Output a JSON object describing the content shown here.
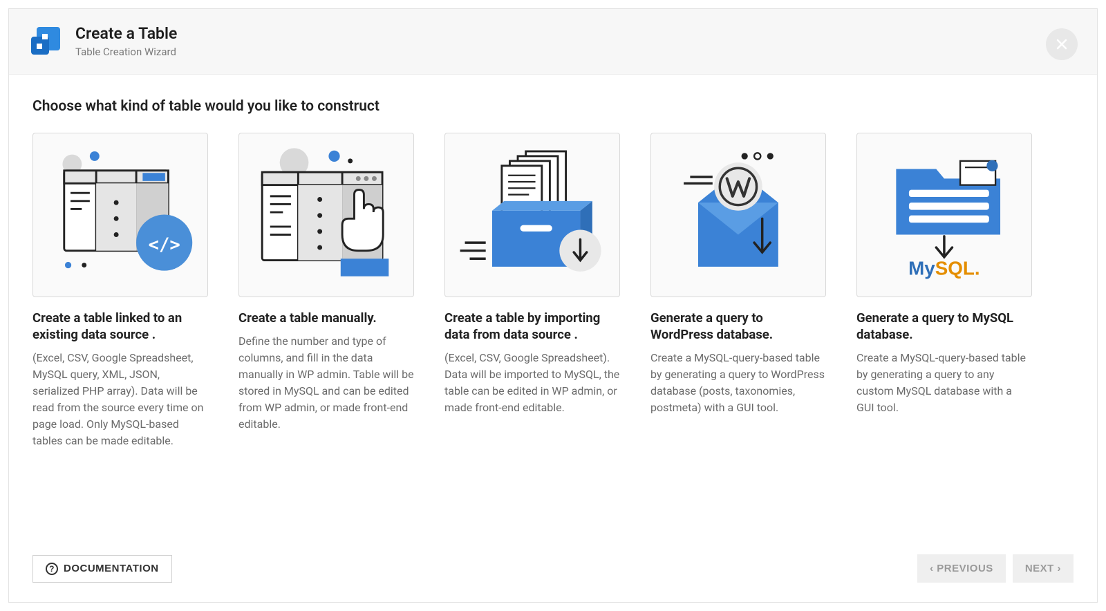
{
  "header": {
    "title": "Create a Table",
    "subtitle": "Table Creation Wizard"
  },
  "prompt": "Choose what kind of table would you like to construct",
  "cards": [
    {
      "title": "Create a table linked to an existing data source .",
      "desc": "(Excel, CSV, Google Spreadsheet, MySQL query, XML, JSON, serialized PHP array). Data will be read from the source every time on page load. Only MySQL-based tables can be made editable."
    },
    {
      "title": "Create a table manually.",
      "desc": "Define the number and type of columns, and fill in the data manually in WP admin. Table will be stored in MySQL and can be edited from WP admin, or made front-end editable."
    },
    {
      "title": "Create a table by importing data from data source .",
      "desc": "(Excel, CSV, Google Spreadsheet). Data will be imported to MySQL, the table can be edited in WP admin, or made front-end editable."
    },
    {
      "title": "Generate a query to WordPress database.",
      "desc": "Create a MySQL-query-based table by generating a query to WordPress database (posts, taxonomies, postmeta) with a GUI tool."
    },
    {
      "title": "Generate a query to MySQL database.",
      "desc": "Create a MySQL-query-based table by generating a query to any custom MySQL database with a GUI tool."
    }
  ],
  "footer": {
    "documentation": "DOCUMENTATION",
    "previous": "PREVIOUS",
    "next": "NEXT"
  }
}
